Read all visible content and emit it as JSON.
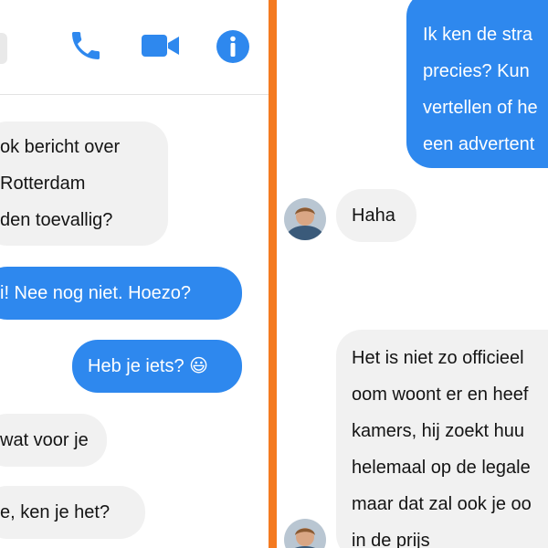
{
  "colors": {
    "accent_blue": "#2e88ee",
    "incoming_bubble": "#f1f1f1",
    "divider_orange": "#f47a20",
    "icon_blue": "#2e88ee"
  },
  "left_panel": {
    "header": {
      "icons": [
        "phone-icon",
        "video-camera-icon",
        "info-icon"
      ]
    },
    "messages": [
      {
        "side": "incoming",
        "text": "ok bericht over\nRotterdam\nden toevallig?"
      },
      {
        "side": "outgoing",
        "text": "i! Nee nog niet. Hoezo?"
      },
      {
        "side": "outgoing",
        "text": "Heb je iets? 😃"
      },
      {
        "side": "incoming",
        "text": "wat voor je"
      },
      {
        "side": "incoming",
        "text": "e, ken je het?"
      }
    ]
  },
  "right_panel": {
    "messages": [
      {
        "side": "outgoing",
        "text": "Ik ken de stra\nprecies? Kun\nvertellen of he\neen advertent"
      },
      {
        "side": "incoming",
        "text": "Haha"
      },
      {
        "side": "incoming",
        "text": "Het is niet zo officieel\noom woont er en heef\nkamers, hij zoekt huu\nhelemaal op de legale\nmaar dat zal ook je oo\nin de prijs"
      }
    ]
  }
}
